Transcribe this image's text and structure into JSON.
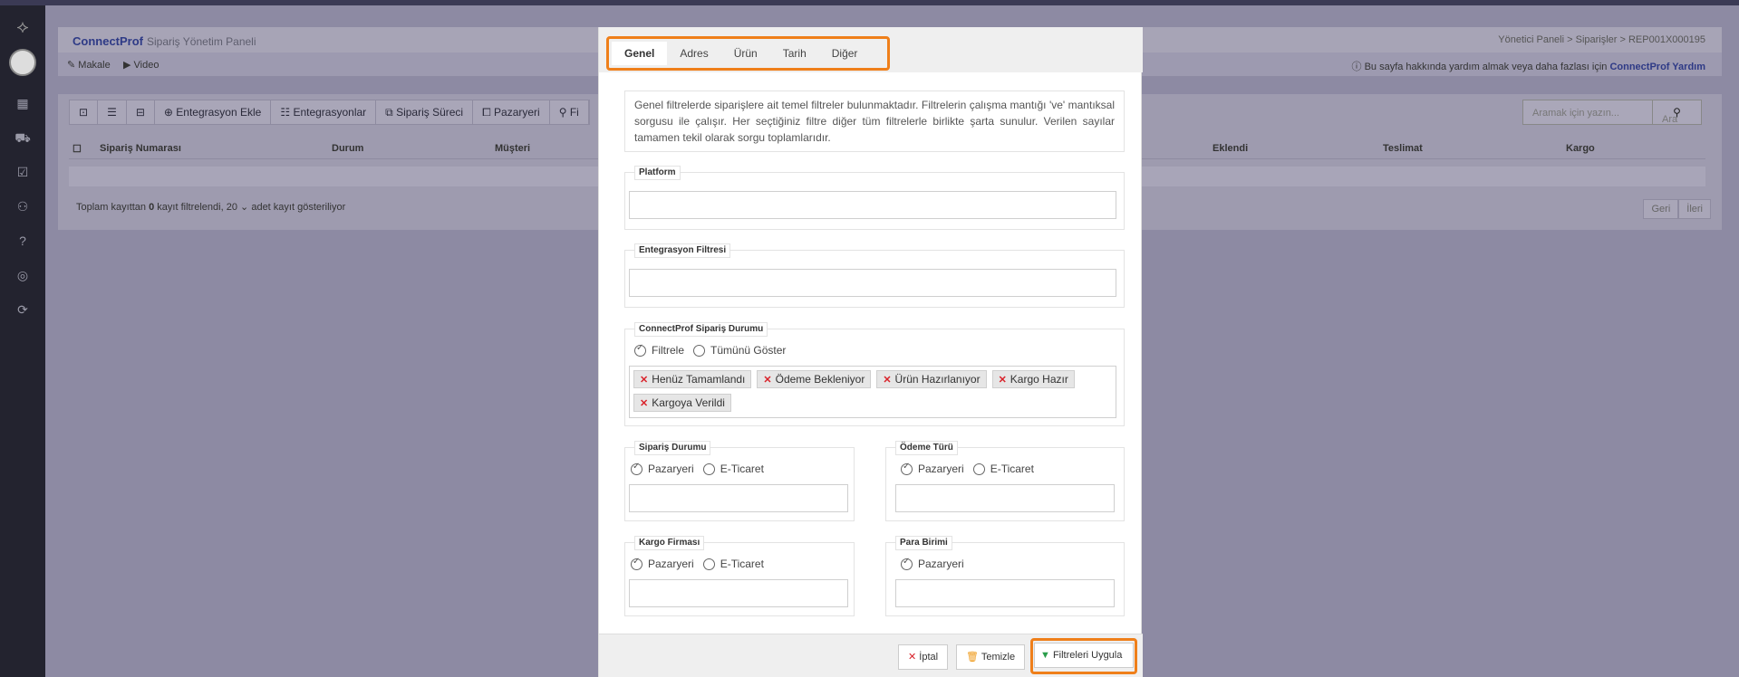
{
  "header": {
    "brand": "ConnectProf",
    "subtitle": "Sipariş Yönetim Paneli",
    "breadcrumb": "Yönetici Paneli  >  Siparişler  >  REP001X000195"
  },
  "subbar": {
    "article": "Makale",
    "video": "Video",
    "help_text": "Bu sayfa hakkında yardım almak veya daha fazlası için",
    "help_link": "ConnectProf Yardım"
  },
  "toolbar": {
    "add_integration": "Entegrasyon Ekle",
    "integrations": "Entegrasyonlar",
    "order_process": "Sipariş Süreci",
    "marketplace": "Pazaryeri",
    "filter": "Fi"
  },
  "search": {
    "placeholder": "Aramak için yazın...",
    "button": "Ara"
  },
  "table": {
    "columns": [
      "Sipariş Numarası",
      "Durum",
      "Müşteri",
      "Eklendi",
      "Teslimat",
      "Kargo"
    ]
  },
  "footer": {
    "text_prefix": "Toplam kayıttan",
    "filtered_count": "0",
    "text_mid": "kayıt filtrelendi,",
    "page_size": "20",
    "text_suffix": "adet kayıt gösteriliyor",
    "prev": "Geri",
    "next": "İleri"
  },
  "modal": {
    "tabs": [
      "Genel",
      "Adres",
      "Ürün",
      "Tarih",
      "Diğer"
    ],
    "active_tab": "Genel",
    "intro": "Genel filtrelerde siparişlere ait temel filtreler bulunmaktadır. Filtrelerin çalışma mantığı 've' mantıksal sorgusu ile çalışır. Her seçtiğiniz filtre diğer tüm filtrelerle birlikte şarta sunulur. Verilen sayılar tamamen tekil olarak sorgu toplamlarıdır.",
    "platform_label": "Platform",
    "integration_filter_label": "Entegrasyon Filtresi",
    "cp_status": {
      "label": "ConnectProf Sipariş Durumu",
      "opt_filter": "Filtrele",
      "opt_show_all": "Tümünü Göster",
      "tags": [
        "Henüz Tamamlandı",
        "Ödeme Bekleniyor",
        "Ürün Hazırlanıyor",
        "Kargo Hazır",
        "Kargoya Verildi"
      ]
    },
    "order_status": {
      "label": "Sipariş Durumu",
      "opt1": "Pazaryeri",
      "opt2": "E-Ticaret"
    },
    "payment_type": {
      "label": "Ödeme Türü",
      "opt1": "Pazaryeri",
      "opt2": "E-Ticaret"
    },
    "cargo_company": {
      "label": "Kargo Firması",
      "opt1": "Pazaryeri",
      "opt2": "E-Ticaret"
    },
    "currency": {
      "label": "Para Birimi",
      "opt1": "Pazaryeri"
    },
    "buttons": {
      "cancel": "İptal",
      "clear": "Temizle",
      "apply": "Filtreleri Uygula"
    }
  },
  "colors": {
    "accent": "#ef7f1a",
    "brand": "#2e3a86",
    "tag_x": "#d9222a"
  }
}
